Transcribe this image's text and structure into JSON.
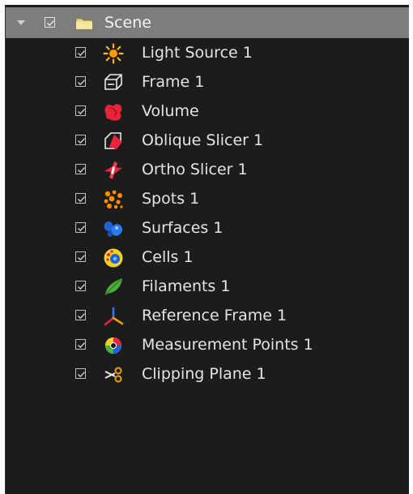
{
  "tree": {
    "root": {
      "label": "Scene",
      "checked": true,
      "expanded": true,
      "icon": "folder-icon"
    },
    "items": [
      {
        "label": "Light Source 1",
        "icon": "light-source-icon",
        "checked": true
      },
      {
        "label": "Frame 1",
        "icon": "frame-icon",
        "checked": true
      },
      {
        "label": "Volume",
        "icon": "volume-icon",
        "checked": true
      },
      {
        "label": "Oblique Slicer 1",
        "icon": "oblique-slicer-icon",
        "checked": true
      },
      {
        "label": "Ortho Slicer 1",
        "icon": "ortho-slicer-icon",
        "checked": true
      },
      {
        "label": "Spots 1",
        "icon": "spots-icon",
        "checked": true
      },
      {
        "label": "Surfaces 1",
        "icon": "surfaces-icon",
        "checked": true
      },
      {
        "label": "Cells 1",
        "icon": "cells-icon",
        "checked": true
      },
      {
        "label": "Filaments 1",
        "icon": "filaments-icon",
        "checked": true
      },
      {
        "label": "Reference Frame 1",
        "icon": "reference-frame-icon",
        "checked": true
      },
      {
        "label": "Measurement Points 1",
        "icon": "measurement-points-icon",
        "checked": true
      },
      {
        "label": "Clipping Plane 1",
        "icon": "clipping-plane-icon",
        "checked": true
      }
    ]
  },
  "colors": {
    "panel_background": "#1c1c1c",
    "selected_row": "#7d7d7d",
    "text": "#e4e4e4"
  }
}
